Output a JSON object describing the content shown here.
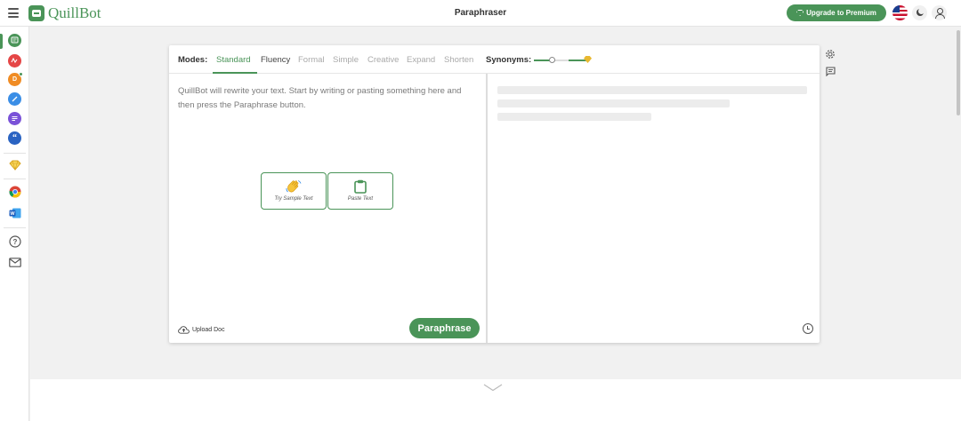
{
  "app": {
    "logo_text": "QuillBot",
    "page_title": "Paraphraser",
    "upgrade_label": "Upgrade to Premium",
    "accent_color": "#4a9458"
  },
  "rail": {
    "items": [
      {
        "name": "paraphraser",
        "icon": "paraphraser-icon",
        "color": "#4a9458"
      },
      {
        "name": "grammar-checker",
        "icon": "grammar-icon",
        "color": "#e54646"
      },
      {
        "name": "ai-detector",
        "icon": "ai-detector-icon",
        "color": "#f08c24"
      },
      {
        "name": "plagiarism",
        "icon": "pen-icon",
        "color": "#3a8ee6"
      },
      {
        "name": "summarizer",
        "icon": "summarizer-icon",
        "color": "#7a52d8"
      },
      {
        "name": "citation",
        "icon": "quote-icon",
        "color": "#2a63c2"
      },
      {
        "name": "premium",
        "icon": "gem-icon",
        "color": "#e8b830"
      },
      {
        "name": "chrome-extension",
        "icon": "chrome-icon"
      },
      {
        "name": "word-addin",
        "icon": "word-icon"
      },
      {
        "name": "help",
        "icon": "help-icon"
      },
      {
        "name": "contact",
        "icon": "mail-icon"
      }
    ]
  },
  "modes": {
    "label": "Modes:",
    "items": [
      "Standard",
      "Fluency",
      "Formal",
      "Simple",
      "Creative",
      "Expand",
      "Shorten"
    ],
    "active": "Standard"
  },
  "synonyms": {
    "label": "Synonyms:"
  },
  "input": {
    "placeholder": "QuillBot will rewrite your text. Start by writing or pasting something here and then press the Paraphrase button.",
    "try_sample_label": "Try Sample Text",
    "paste_label": "Paste Text",
    "upload_label": "Upload Doc",
    "paraphrase_label": "Paraphrase"
  }
}
